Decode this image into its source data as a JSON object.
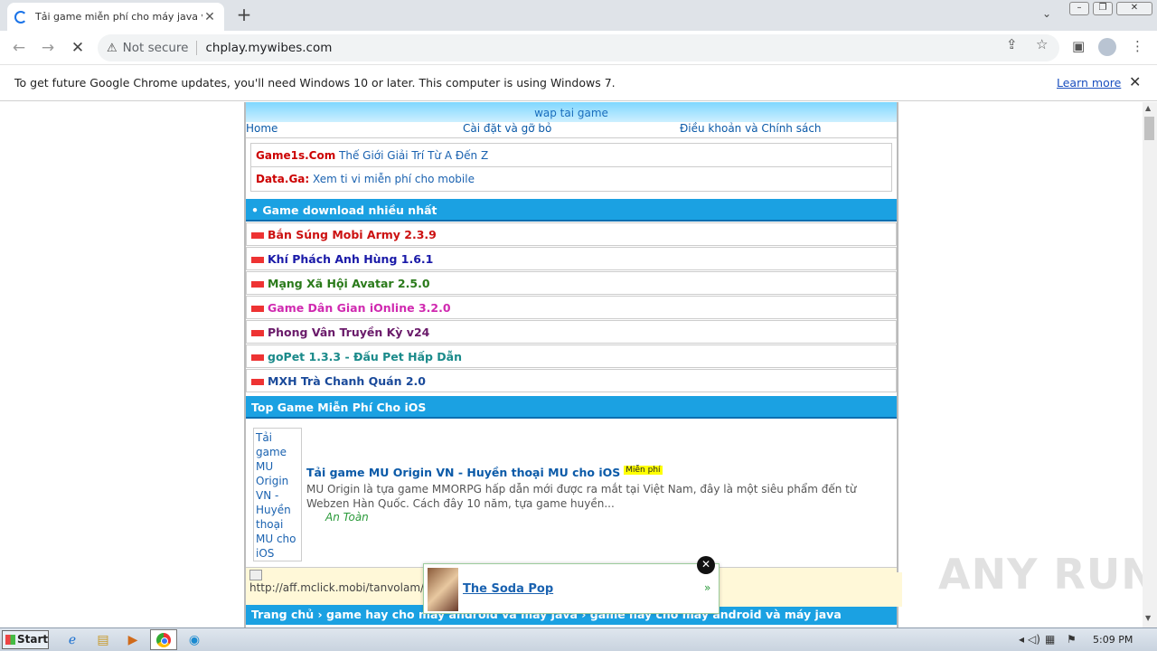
{
  "browser": {
    "tab_title": "Tải game miễn phí cho máy java và a",
    "security_label": "Not secure",
    "url": "chplay.mywibes.com",
    "infobar_text": "To get future Google Chrome updates, you'll need Windows 10 or later. This computer is using Windows 7.",
    "infobar_link": "Learn more"
  },
  "site": {
    "banner_alt": "wap tai game",
    "menu": [
      "Home",
      "Cài đặt và gỡ bỏ",
      "Điều khoản và Chính sách"
    ],
    "promo": [
      {
        "brand": "Game1s.Com",
        "text": "Thế Giới Giải Trí Từ A Đến Z"
      },
      {
        "brand": "Data.Ga:",
        "text": "Xem ti vi miễn phí cho mobile"
      }
    ],
    "top_section": "• Game download nhiều nhất",
    "games": [
      {
        "title": "Bắn Súng Mobi Army 2.3.9",
        "color": "#cc1111"
      },
      {
        "title": "Khí Phách Anh Hùng 1.6.1",
        "color": "#1a1aa8"
      },
      {
        "title": "Mạng Xã Hội Avatar 2.5.0",
        "color": "#2a7a1a"
      },
      {
        "title": "Game Dân Gian iOnline 3.2.0",
        "color": "#d02ab0"
      },
      {
        "title": "Phong Vân Truyền Kỳ v24",
        "color": "#6a1a6a"
      },
      {
        "title": "goPet 1.3.3 - Đấu Pet Hấp Dẫn",
        "color": "#1a8a8a"
      },
      {
        "title": "MXH Trà Chanh Quán 2.0",
        "color": "#1a4a9a"
      }
    ],
    "ios_section": "Top Game Miễn Phí Cho iOS",
    "ios_item": {
      "thumb_alt": "Tải game MU Origin VN - Huyền thoại MU cho iOS",
      "title": "Tải game MU Origin VN - Huyền thoại MU cho iOS",
      "badge": "Miễn phí",
      "description": "MU Origin là tựa game MMORPG hấp dẫn mới được ra mắt tại Việt Nam, đây là một siêu phẩm đến từ Webzen Hàn Quốc. Cách đây 10 năm, tựa game huyền...",
      "safe": "An Toàn"
    },
    "aff_text": "http://aff.mclick.mobi/tanvolam/ap",
    "breadcrumb": "Trang chủ › game hay cho máy android và máy java › game hay cho máy android và máy java"
  },
  "popup": {
    "title": "The Soda Pop",
    "arrow": "»",
    "close": "✕"
  },
  "watermark": "ANY RUN",
  "taskbar": {
    "start": "Start",
    "clock": "5:09 PM"
  }
}
